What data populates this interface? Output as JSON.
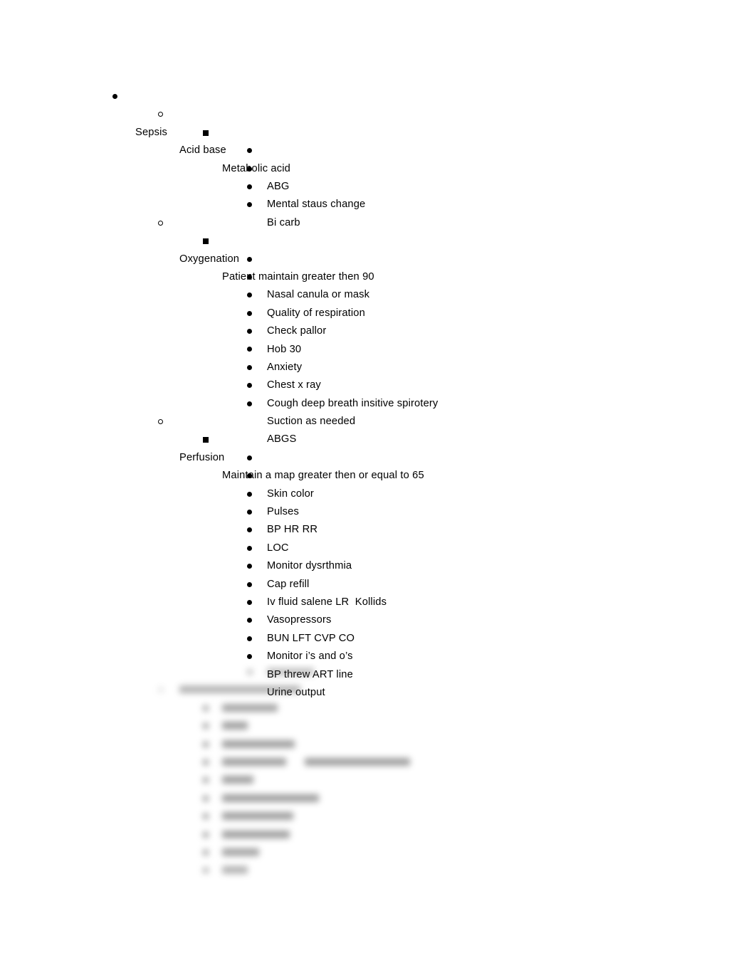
{
  "document": {
    "title": "Sepsis",
    "background_color": "#ffffff",
    "text_color": "#000000"
  },
  "bullet_glyphs": {
    "level1": "●",
    "level2": "○",
    "level3": "▪",
    "level4": "●"
  },
  "outline": {
    "root_label": "Sepsis",
    "sections": [
      {
        "label": "Acid base",
        "subsections": [
          {
            "label": "Metabolic acid",
            "items": [
              "ABG",
              "Mental staus change",
              "Bi carb",
              ""
            ]
          }
        ]
      },
      {
        "label": "Oxygenation",
        "subsections": [
          {
            "label": "Patient maintain greater then 90",
            "items": [
              "Nasal canula or mask",
              "Quality of respiration",
              "Check pallor",
              "Hob 30",
              "Anxiety",
              "Chest x ray",
              "Cough deep breath insitive spirotery",
              "Suction as needed",
              "ABGS"
            ]
          }
        ]
      },
      {
        "label": "Perfusion",
        "subsections": [
          {
            "label": "Maintain a map greater then or equal to 65",
            "items": [
              "Skin color",
              "Pulses",
              "BP HR RR",
              "LOC",
              "Monitor dysrthmia",
              "Cap refill",
              "Iv fluid salene LR  Kollids",
              "Vasopressors",
              "BUN LFT CVP CO",
              "Monitor i’s and o’s",
              "BP threw ART line",
              "Urine output"
            ]
          }
        ]
      }
    ]
  },
  "redacted_tail": {
    "note": "Lower portion of the page is blurred and illegible in the source screenshot.",
    "rows": [
      {
        "indent": "level4",
        "bullet": "●",
        "widths": [
          66
        ]
      },
      {
        "indent": "level2",
        "bullet": "○",
        "widths": [
          170
        ]
      },
      {
        "indent": "level3",
        "bullet": "▪",
        "widths": [
          78
        ]
      },
      {
        "indent": "level3",
        "bullet": "▪",
        "widths": [
          36
        ]
      },
      {
        "indent": "level3",
        "bullet": "▪",
        "widths": [
          102
        ]
      },
      {
        "indent": "level3",
        "bullet": "▪",
        "widths": [
          90,
          148
        ]
      },
      {
        "indent": "level3",
        "bullet": "▪",
        "widths": [
          44
        ]
      },
      {
        "indent": "level3",
        "bullet": "▪",
        "widths": [
          136
        ]
      },
      {
        "indent": "level3",
        "bullet": "▪",
        "widths": [
          100
        ]
      },
      {
        "indent": "level3",
        "bullet": "▪",
        "widths": [
          95
        ]
      },
      {
        "indent": "level3",
        "bullet": "▪",
        "widths": [
          52
        ]
      },
      {
        "indent": "level3",
        "bullet": "▪",
        "widths": [
          36
        ]
      }
    ]
  }
}
